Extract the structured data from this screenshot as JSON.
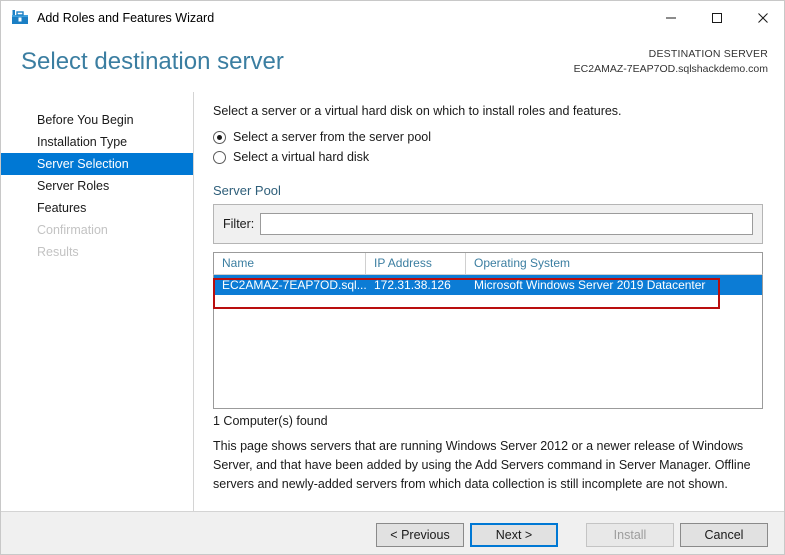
{
  "window": {
    "title": "Add Roles and Features Wizard",
    "icon": "wizard-toolbox-icon",
    "controls": {
      "minimize": "minimize-icon",
      "maximize": "maximize-icon",
      "close": "close-icon"
    }
  },
  "header": {
    "page_title": "Select destination server",
    "destination_label": "DESTINATION SERVER",
    "destination_name": "EC2AMAZ-7EAP7OD.sqlshackdemo.com"
  },
  "sidebar": {
    "items": [
      {
        "label": "Before You Begin",
        "state": "normal"
      },
      {
        "label": "Installation Type",
        "state": "normal"
      },
      {
        "label": "Server Selection",
        "state": "selected"
      },
      {
        "label": "Server Roles",
        "state": "normal"
      },
      {
        "label": "Features",
        "state": "normal"
      },
      {
        "label": "Confirmation",
        "state": "disabled"
      },
      {
        "label": "Results",
        "state": "disabled"
      }
    ]
  },
  "main": {
    "intro": "Select a server or a virtual hard disk on which to install roles and features.",
    "radios": [
      {
        "label": "Select a server from the server pool",
        "checked": true
      },
      {
        "label": "Select a virtual hard disk",
        "checked": false
      }
    ],
    "server_pool_label": "Server Pool",
    "filter": {
      "label": "Filter:",
      "value": "",
      "placeholder": ""
    },
    "table": {
      "columns": [
        "Name",
        "IP Address",
        "Operating System"
      ],
      "rows": [
        {
          "name": "EC2AMAZ-7EAP7OD.sql...",
          "ip": "172.31.38.126",
          "os": "Microsoft Windows Server 2019 Datacenter",
          "selected": true
        }
      ]
    },
    "found_text": "1 Computer(s) found",
    "description": "This page shows servers that are running Windows Server 2012 or a newer release of Windows Server, and that have been added by using the Add Servers command in Server Manager. Offline servers and newly-added servers from which data collection is still incomplete are not shown."
  },
  "annotation": {
    "shape": "rectangle",
    "color": "#b90e0e"
  },
  "footer": {
    "buttons": [
      {
        "label": "< Previous",
        "state": "normal"
      },
      {
        "label": "Next >",
        "state": "focused"
      },
      {
        "label": "Install",
        "state": "disabled"
      },
      {
        "label": "Cancel",
        "state": "normal"
      }
    ]
  },
  "colors": {
    "accent": "#0078d4",
    "selection": "#0c7cd5",
    "title_blue": "#3b7ea1",
    "annotation_red": "#b90e0e"
  }
}
